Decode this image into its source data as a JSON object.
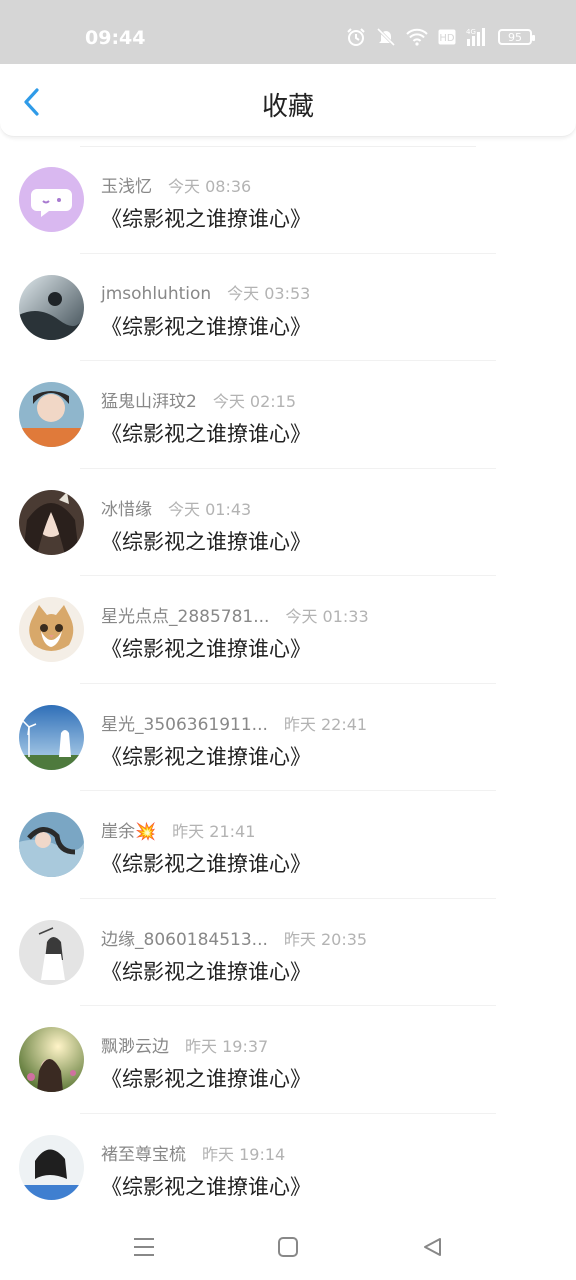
{
  "status_bar": {
    "time": "09:44",
    "battery": "95",
    "icons": [
      "alarm-icon",
      "mute-icon",
      "wifi-icon",
      "hd-icon",
      "signal-4g-icon",
      "battery-icon"
    ]
  },
  "header": {
    "title": "收藏",
    "back_icon": "chevron-left-icon",
    "accent_color": "#2f9be8"
  },
  "items": [
    {
      "name": "玉浅忆",
      "time": "今天 08:36",
      "content": "《综影视之谁撩谁心》",
      "avatar": "chat-bubble-avatar"
    },
    {
      "name": "jmsohluhtion",
      "time": "今天 03:53",
      "content": "《综影视之谁撩谁心》",
      "avatar": "photo-avatar"
    },
    {
      "name": "猛鬼山湃玟2",
      "time": "今天 02:15",
      "content": "《综影视之谁撩谁心》",
      "avatar": "photo-avatar"
    },
    {
      "name": "冰惜缘",
      "time": "今天 01:43",
      "content": "《综影视之谁撩谁心》",
      "avatar": "photo-avatar"
    },
    {
      "name": "星光点点_2885781...",
      "time": "今天 01:33",
      "content": "《综影视之谁撩谁心》",
      "avatar": "cat-avatar"
    },
    {
      "name": "星光_3506361911...",
      "time": "昨天 22:41",
      "content": "《综影视之谁撩谁心》",
      "avatar": "photo-avatar"
    },
    {
      "name": "崖余💥",
      "time": "昨天 21:41",
      "content": "《综影视之谁撩谁心》",
      "avatar": "photo-avatar"
    },
    {
      "name": "边缘_8060184513...",
      "time": "昨天 20:35",
      "content": "《综影视之谁撩谁心》",
      "avatar": "photo-avatar"
    },
    {
      "name": "飘渺云边",
      "time": "昨天 19:37",
      "content": "《综影视之谁撩谁心》",
      "avatar": "photo-avatar"
    },
    {
      "name": "褚至尊宝梳",
      "time": "昨天 19:14",
      "content": "《综影视之谁撩谁心》",
      "avatar": "photo-avatar"
    }
  ],
  "nav": {
    "menu_icon": "menu-icon",
    "home_icon": "square-home-icon",
    "back_icon": "triangle-back-icon"
  }
}
